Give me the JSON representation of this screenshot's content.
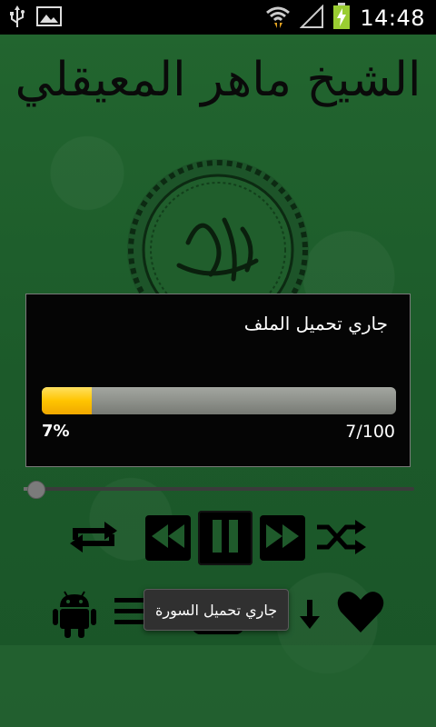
{
  "status_bar": {
    "time": "14:48",
    "icons": [
      "usb-icon",
      "image-icon",
      "wifi-icon",
      "signal-icon",
      "battery-charging-icon"
    ]
  },
  "app": {
    "title": "الشيخ ماهر المعيقلي"
  },
  "dialog": {
    "title": "جاري تحميل الملف",
    "progress_percent_label": "7%",
    "progress_count_label": "7/100",
    "progress_fraction": 0.14
  },
  "player": {
    "seek_fraction": 0.02,
    "controls": [
      "repeat-icon",
      "rewind-icon",
      "pause-icon",
      "fast-forward-icon",
      "shuffle-icon"
    ]
  },
  "bottom_bar": {
    "icons": [
      "android-icon",
      "list-icon",
      "download-icon",
      "heart-icon"
    ]
  },
  "toast": {
    "text": "جاري تحميل السورة"
  },
  "colors": {
    "background": "#1c5a2c",
    "progress_fill": "#ffc400",
    "progress_track": "#8e918b"
  }
}
